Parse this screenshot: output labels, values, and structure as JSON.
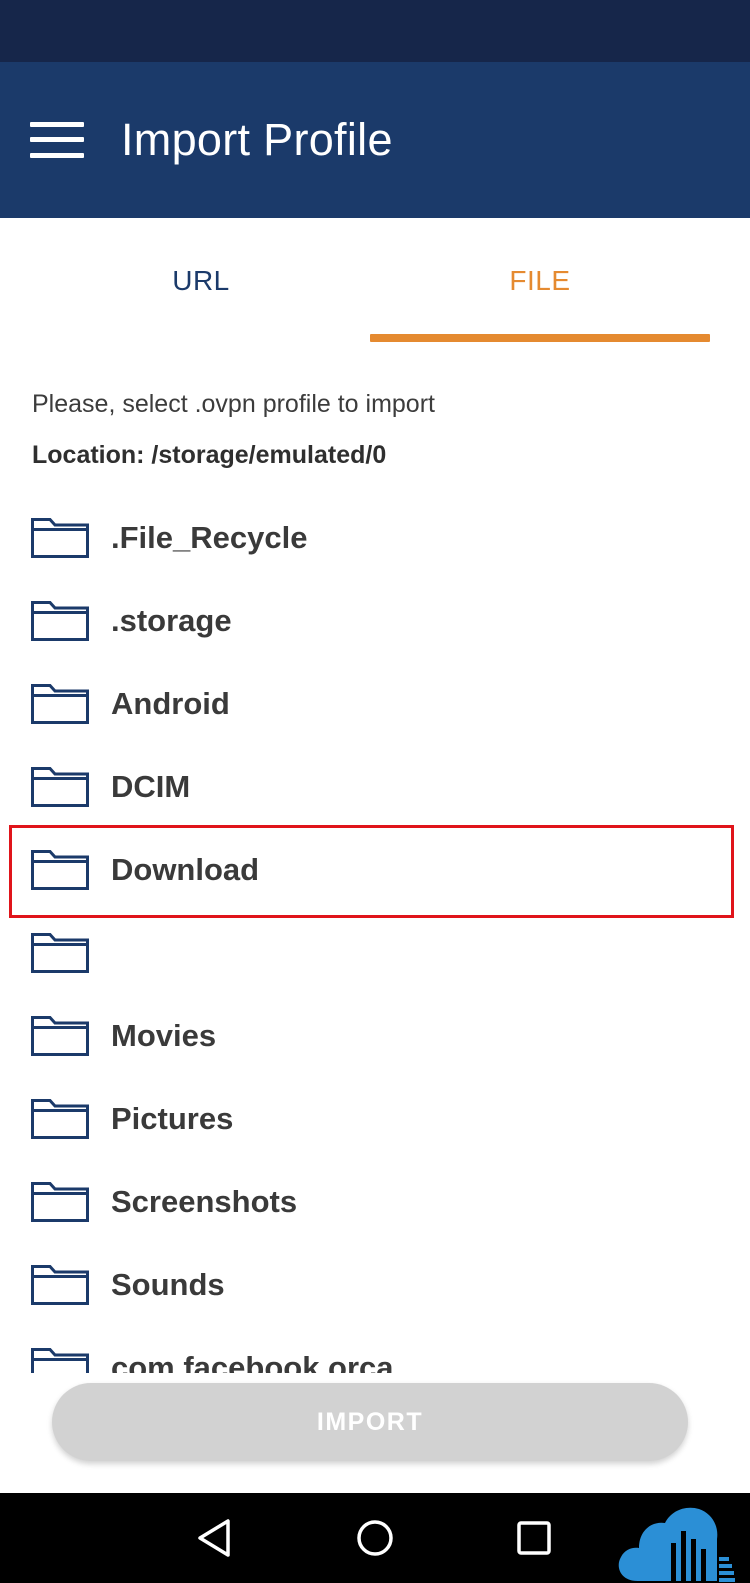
{
  "app_bar": {
    "title": "Import Profile",
    "menu_icon": "hamburger-menu-icon"
  },
  "tabs": [
    {
      "label": "URL",
      "selected": false
    },
    {
      "label": "FILE",
      "selected": true
    }
  ],
  "colors": {
    "app_bar": "#1b3a6a",
    "status_bar": "#16264a",
    "accent": "#e58a30",
    "highlight": "#e0141a",
    "folder_icon": "#1b3a6a",
    "disabled_button": "#d2d2d2"
  },
  "file_browser": {
    "instruction": "Please, select .ovpn profile to import",
    "location": "Location: /storage/emulated/0",
    "items": [
      {
        "name": ".File_Recycle",
        "icon": "folder-icon"
      },
      {
        "name": ".storage",
        "icon": "folder-icon"
      },
      {
        "name": "Android",
        "icon": "folder-icon"
      },
      {
        "name": "DCIM",
        "icon": "folder-icon"
      },
      {
        "name": "Download",
        "icon": "folder-icon",
        "highlighted": true
      },
      {
        "name": "",
        "icon": "folder-icon"
      },
      {
        "name": "Movies",
        "icon": "folder-icon"
      },
      {
        "name": "Pictures",
        "icon": "folder-icon"
      },
      {
        "name": "Screenshots",
        "icon": "folder-icon"
      },
      {
        "name": "Sounds",
        "icon": "folder-icon"
      },
      {
        "name": "com.facebook.orca",
        "icon": "folder-icon"
      }
    ]
  },
  "import_button": {
    "label": "IMPORT",
    "enabled": false
  },
  "nav_bar": {
    "buttons": [
      "back-icon",
      "home-icon",
      "recent-apps-icon"
    ],
    "logo": "cloud-logo-icon"
  }
}
